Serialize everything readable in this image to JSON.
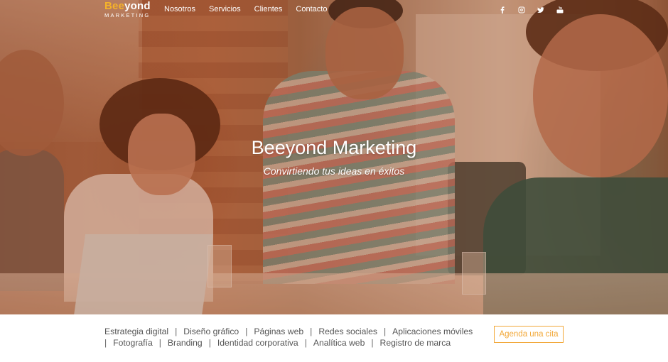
{
  "brand": {
    "name_part1": "Bee",
    "name_part2": "yond",
    "tagline": "MARKETING",
    "accent_color": "#f5b22a"
  },
  "nav": {
    "items": [
      "Nosotros",
      "Servicios",
      "Clientes",
      "Contacto"
    ]
  },
  "social": {
    "icons": [
      "facebook-icon",
      "instagram-icon",
      "twitter-icon",
      "youtube-icon"
    ]
  },
  "hero": {
    "title": "Beeyond Marketing",
    "subtitle": "Convirtiendo tus ideas en éxitos"
  },
  "services": {
    "row1": [
      "Estrategia digital",
      "Diseño gráfico",
      "Páginas web",
      "Redes sociales",
      "Aplicaciones móviles"
    ],
    "row2": [
      "Fotografía",
      "Branding",
      "Identidad corporativa",
      "Analítica web",
      "Registro de marca"
    ],
    "separator": "|"
  },
  "cta": {
    "label": "Agenda una cita",
    "color": "#f2a838"
  }
}
